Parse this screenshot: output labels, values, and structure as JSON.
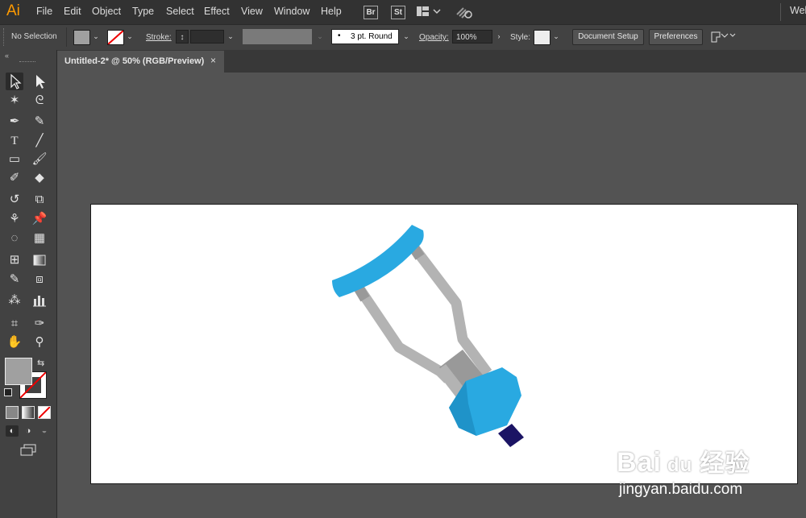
{
  "app": {
    "logo": "Ai"
  },
  "menu": [
    "File",
    "Edit",
    "Object",
    "Type",
    "Select",
    "Effect",
    "View",
    "Window",
    "Help"
  ],
  "menu_right": {
    "bridge": "Br",
    "stock": "St",
    "workspace": "Web"
  },
  "control": {
    "selection": "No Selection",
    "stroke_label": "Stroke:",
    "brush_label": "3 pt. Round",
    "opacity_label": "Opacity:",
    "opacity_value": "100%",
    "style_label": "Style:",
    "document_setup": "Document Setup",
    "preferences": "Preferences"
  },
  "tab": {
    "title": "Untitled-2* @ 50% (RGB/Preview)",
    "close": "×"
  },
  "tools": [
    "selection-tool",
    "direct-selection-tool",
    "magic-wand-tool",
    "lasso-tool",
    "pen-tool",
    "curvature-tool",
    "type-tool",
    "line-tool",
    "rectangle-tool",
    "paintbrush-tool",
    "shaper-tool",
    "eraser-tool",
    "rotate-tool",
    "scale-tool",
    "puppet-warp-tool",
    "pin-tool",
    "shape-builder-tool",
    "perspective-grid-tool",
    "mesh-tool",
    "gradient-tool",
    "eyedropper-tool",
    "blend-tool",
    "symbol-sprayer-tool",
    "column-graph-tool",
    "artboard-tool",
    "slice-tool",
    "hand-tool",
    "zoom-tool"
  ],
  "colors": {
    "crutch_blue": "#29a9e1",
    "crutch_blue_dark": "#1f93c9",
    "crutch_gray": "#b3b3b3",
    "crutch_gray_dark": "#999999",
    "tip_navy": "#1b1464",
    "fill_swatch": "#a0a0a0",
    "accent_orange": "#ff9a00"
  },
  "watermark": {
    "brand": "Bai",
    "brand2": "du",
    "brand_cn": "经验",
    "url": "jingyan.baidu.com"
  }
}
